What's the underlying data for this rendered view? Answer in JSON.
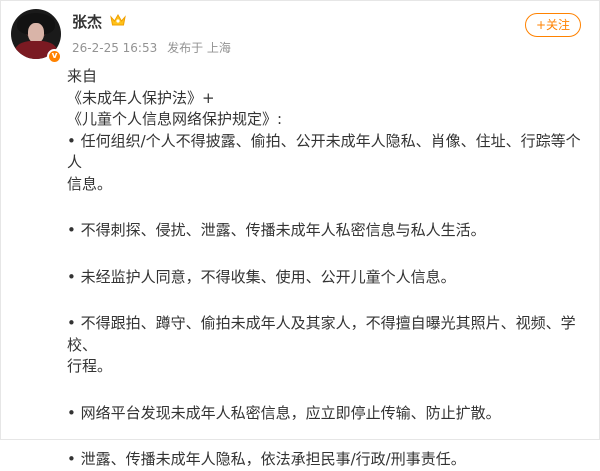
{
  "author": {
    "name": "张杰",
    "verify_icon": "verified-badge-icon",
    "vip_icon": "crown-icon"
  },
  "post_meta": {
    "time": "26-2-25 16:53",
    "location": "发布于 上海"
  },
  "follow_button": {
    "label": "+关注",
    "color": "#ff8200"
  },
  "post": {
    "intro_lines": [
      "来自",
      "《未成年人保护法》+",
      "《儿童个人信息网络保护规定》:"
    ],
    "bullets": [
      [
        "• 任何组织/个人不得披露、偷拍、公开未成年人隐私、肖像、住址、行踪等个人",
        "信息。"
      ],
      [
        "• 不得刺探、侵扰、泄露、传播未成年人私密信息与私人生活。"
      ],
      [
        "• 未经监护人同意，不得收集、使用、公开儿童个人信息。"
      ],
      [
        "• 不得跟拍、蹲守、偷拍未成年人及其家人，不得擅自曝光其照片、视频、学校、",
        "行程。"
      ],
      [
        "• 网络平台发现未成年人私密信息，应立即停止传输、防止扩散。"
      ],
      [
        "• 泄露、传播未成年人隐私，依法承担民事/行政/刑事责任。"
      ]
    ]
  }
}
